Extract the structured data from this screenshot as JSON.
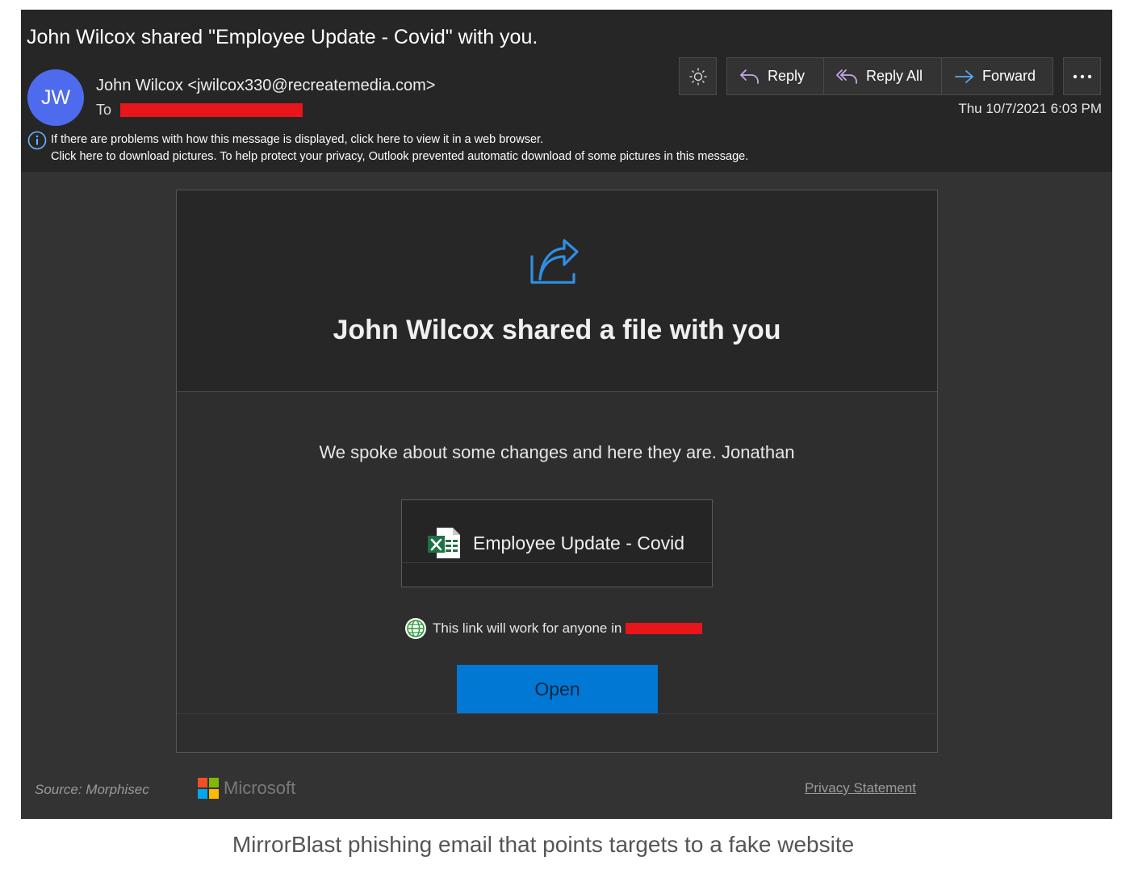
{
  "email": {
    "subject": "John Wilcox shared \"Employee Update - Covid\" with you.",
    "avatar_initials": "JW",
    "sender": "John Wilcox <jwilcox330@recreatemedia.com>",
    "to_label": "To",
    "date": "Thu 10/7/2021 6:03 PM",
    "notice_line1": "If there are problems with how this message is displayed, click here to view it in a web browser.",
    "notice_line2": "Click here to download pictures. To help protect your privacy, Outlook prevented automatic download of some pictures in this message."
  },
  "toolbar": {
    "reply_label": "Reply",
    "reply_all_label": "Reply All",
    "forward_label": "Forward"
  },
  "card": {
    "headline": "John Wilcox shared a file with you",
    "message": "We spoke about some changes and here they are. Jonathan",
    "file_name": "Employee Update - Covid",
    "link_notice": "This link will work for anyone in",
    "open_label": "Open"
  },
  "footer": {
    "source": "Source: Morphisec",
    "brand": "Microsoft",
    "privacy_label": "Privacy Statement"
  },
  "caption": "MirrorBlast phishing email that points targets to a fake website",
  "colors": {
    "accent_blue": "#0078d4",
    "avatar_blue": "#4f6bed",
    "redaction_red": "#e8151b",
    "excel_green": "#1e7145"
  },
  "icons": [
    "theme-sun-icon",
    "reply-icon",
    "reply-all-icon",
    "forward-arrow-icon",
    "more-dots-icon",
    "info-icon",
    "share-icon",
    "excel-file-icon",
    "globe-icon",
    "microsoft-logo-icon"
  ]
}
